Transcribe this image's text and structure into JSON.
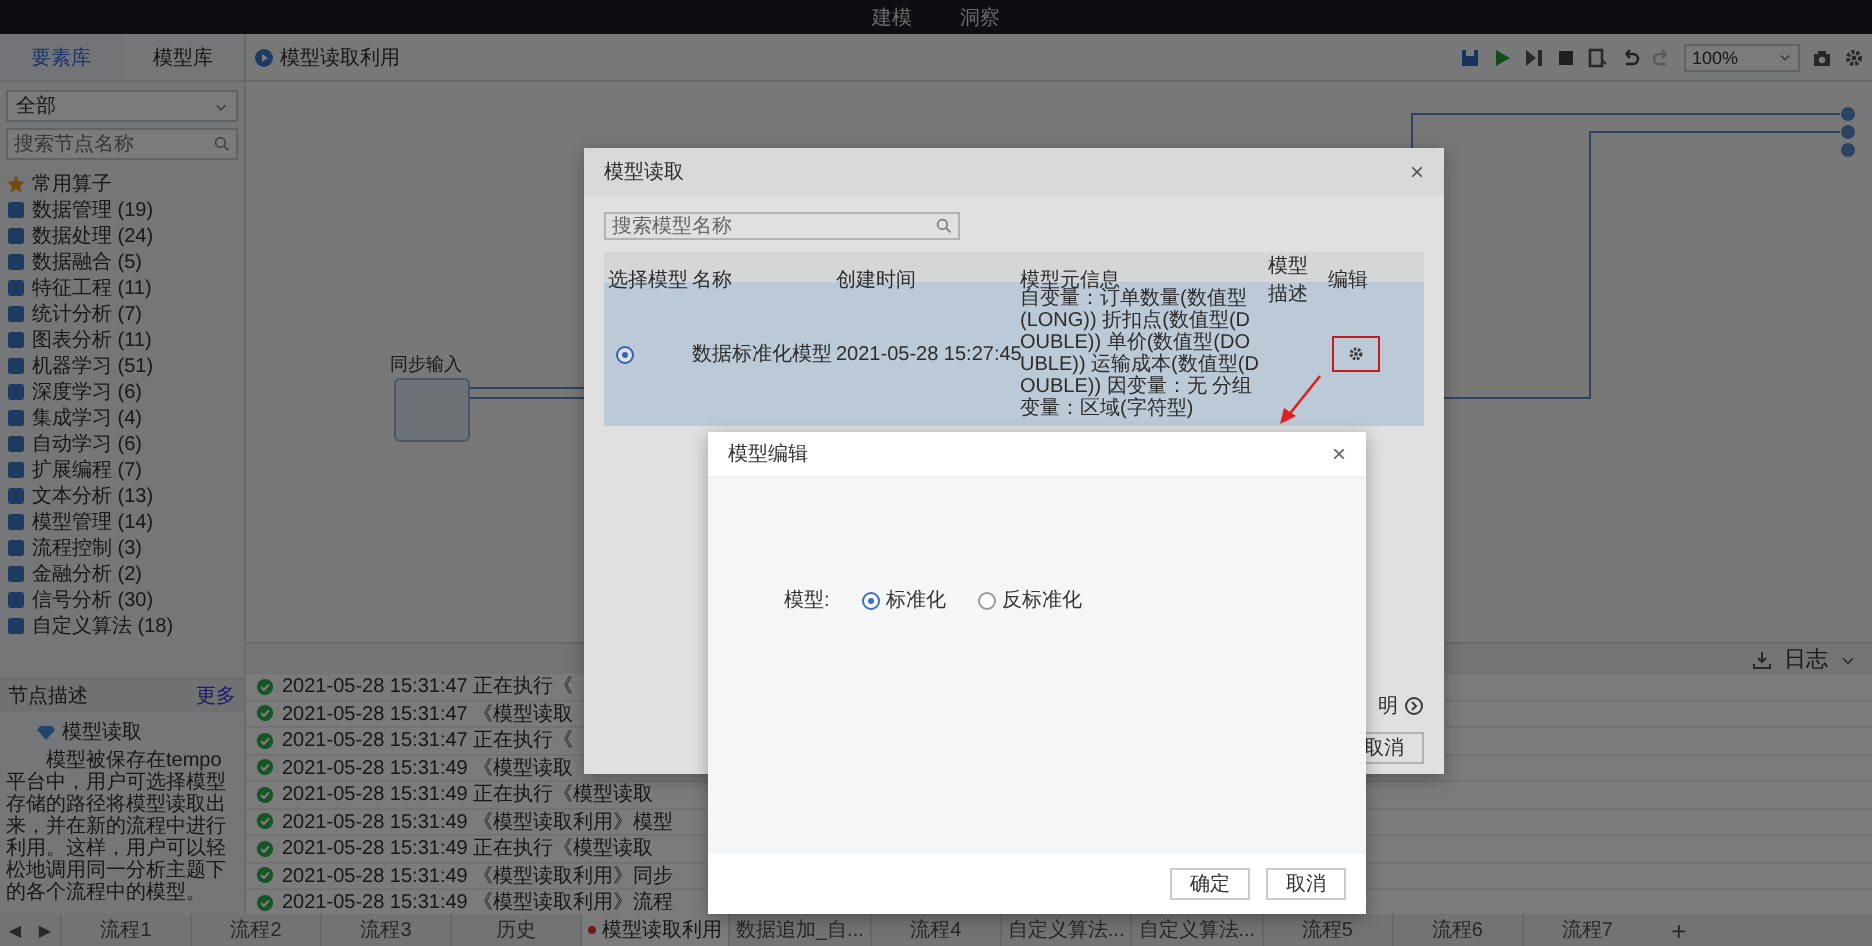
{
  "top_nav": [
    {
      "label": "建模"
    },
    {
      "label": "洞察"
    }
  ],
  "sidebar": {
    "tabs": [
      {
        "label": "要素库",
        "selected": true
      },
      {
        "label": "模型库",
        "selected": false
      }
    ],
    "filter": "全部",
    "search": {
      "placeholder": "搜索节点名称"
    },
    "categories": [
      {
        "label": "常用算子",
        "kind": "favorite"
      },
      {
        "label": "数据管理 (19)",
        "kind": "category"
      },
      {
        "label": "数据处理 (24)",
        "kind": "category"
      },
      {
        "label": "数据融合 (5)",
        "kind": "category"
      },
      {
        "label": "特征工程 (11)",
        "kind": "category"
      },
      {
        "label": "统计分析 (7)",
        "kind": "category"
      },
      {
        "label": "图表分析 (11)",
        "kind": "category"
      },
      {
        "label": "机器学习 (51)",
        "kind": "category"
      },
      {
        "label": "深度学习 (6)",
        "kind": "category"
      },
      {
        "label": "集成学习 (4)",
        "kind": "category"
      },
      {
        "label": "自动学习 (6)",
        "kind": "category"
      },
      {
        "label": "扩展编程 (7)",
        "kind": "category"
      },
      {
        "label": "文本分析 (13)",
        "kind": "category"
      },
      {
        "label": "模型管理 (14)",
        "kind": "category"
      },
      {
        "label": "流程控制 (3)",
        "kind": "category"
      },
      {
        "label": "金融分析 (2)",
        "kind": "category"
      },
      {
        "label": "信号分析 (30)",
        "kind": "category"
      },
      {
        "label": "自定义算法 (18)",
        "kind": "category"
      }
    ],
    "description": {
      "title": "节点描述",
      "more": "更多",
      "node": "模型读取",
      "text": "模型被保存在tempo平台中，用户可选择模型存储的路径将模型读取出来，并在新的流程中进行利用。这样，用户可以轻松地调用同一分析主题下的各个流程中的模型。"
    }
  },
  "flow_tab": "模型读取利用",
  "toolbar": {
    "zoom": "100%"
  },
  "canvas": {
    "node": "同步输入"
  },
  "log": {
    "title": "日志",
    "rows": [
      {
        "text": "2021-05-28 15:31:47 正在执行《",
        "success": true
      },
      {
        "text": "2021-05-28 15:31:47 《模型读取",
        "success": true
      },
      {
        "text": "2021-05-28 15:31:47 正在执行《",
        "success": true
      },
      {
        "text": "2021-05-28 15:31:49 《模型读取",
        "success": true
      },
      {
        "text": "2021-05-28 15:31:49 正在执行《模型读取",
        "success": true
      },
      {
        "text": "2021-05-28 15:31:49 《模型读取利用》模型",
        "success": true
      },
      {
        "text": "2021-05-28 15:31:49 正在执行《模型读取",
        "success": true
      },
      {
        "text": "2021-05-28 15:31:49 《模型读取利用》同步",
        "success": true
      },
      {
        "text": "2021-05-28 15:31:49 《模型读取利用》流程",
        "success": true
      }
    ]
  },
  "nav_arrows": [
    "◀",
    "▶"
  ],
  "bottom_tabs": [
    {
      "label": "流程1",
      "selected": false,
      "modified": false
    },
    {
      "label": "流程2",
      "selected": false,
      "modified": false
    },
    {
      "label": "流程3",
      "selected": false,
      "modified": false
    },
    {
      "label": "历史",
      "selected": false,
      "modified": false
    },
    {
      "label": "模型读取利用",
      "selected": true,
      "modified": true
    },
    {
      "label": "数据追加_自...",
      "selected": false,
      "modified": false
    },
    {
      "label": "流程4",
      "selected": false,
      "modified": false
    },
    {
      "label": "自定义算法...",
      "selected": false,
      "modified": false
    },
    {
      "label": "自定义算法...",
      "selected": false,
      "modified": false
    },
    {
      "label": "流程5",
      "selected": false,
      "modified": false
    },
    {
      "label": "流程6",
      "selected": false,
      "modified": false
    },
    {
      "label": "流程7",
      "selected": false,
      "modified": false
    }
  ],
  "add_tab": "+",
  "read_dialog": {
    "title": "模型读取",
    "close": "×",
    "search": {
      "placeholder": "搜索模型名称"
    },
    "columns": [
      "选择模型",
      "名称",
      "创建时间",
      "模型元信息",
      "模型描述",
      "编辑"
    ],
    "rows": [
      {
        "selected": true,
        "name": "数据标准化模型",
        "created": "2021-05-28 15:27:45",
        "meta": "自变量：订单数量(数值型(LONG)) 折扣点(数值型(DOUBLE)) 单价(数值型(DOUBLE)) 运输成本(数值型(DOUBLE)) 因变量：无 分组变量：区域(字符型)",
        "highlighted_edit": true
      }
    ],
    "help": "明",
    "cancel": "取消"
  },
  "edit_dialog": {
    "title": "模型编辑",
    "close": "×",
    "field_label": "模型:",
    "options": [
      {
        "label": "标准化",
        "selected": true
      },
      {
        "label": "反标准化",
        "selected": false
      }
    ],
    "ok": "确定",
    "cancel": "取消"
  }
}
